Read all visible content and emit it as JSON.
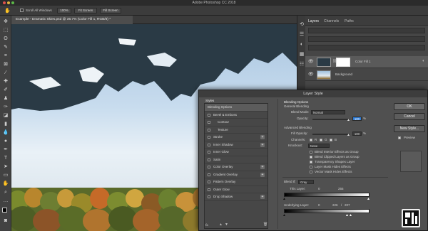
{
  "titlebar": {
    "title": "Adobe Photoshop CC 2018"
  },
  "options_bar": {
    "scroll_all_windows": "Scroll All Windows",
    "zoom": "100%",
    "fit_screen": "Fit Screen",
    "fill_screen": "Fill Screen"
  },
  "document": {
    "tab_title": "Example - Dramatic Skies.psd @ 36.7% (Color Fill 1, RGB/8) *"
  },
  "layers_panel": {
    "tabs": [
      "Layers",
      "Channels",
      "Paths"
    ],
    "layers": [
      {
        "name": "Color Fill 1"
      },
      {
        "name": "Background"
      }
    ]
  },
  "dialog": {
    "title": "Layer Style",
    "styles_header": "Styles",
    "style_items": [
      {
        "label": "Blending Options",
        "plus": false,
        "checkbox": false
      },
      {
        "label": "Bevel & Emboss",
        "plus": false,
        "checkbox": true
      },
      {
        "label": "Contour",
        "plus": false,
        "checkbox": true
      },
      {
        "label": "Texture",
        "plus": false,
        "checkbox": true
      },
      {
        "label": "Stroke",
        "plus": true,
        "checkbox": true
      },
      {
        "label": "Inner Shadow",
        "plus": true,
        "checkbox": true
      },
      {
        "label": "Inner Glow",
        "plus": false,
        "checkbox": true
      },
      {
        "label": "Satin",
        "plus": false,
        "checkbox": true
      },
      {
        "label": "Color Overlay",
        "plus": true,
        "checkbox": true
      },
      {
        "label": "Gradient Overlay",
        "plus": true,
        "checkbox": true
      },
      {
        "label": "Pattern Overlay",
        "plus": false,
        "checkbox": true
      },
      {
        "label": "Outer Glow",
        "plus": false,
        "checkbox": true
      },
      {
        "label": "Drop Shadow",
        "plus": true,
        "checkbox": true
      }
    ],
    "fx_label": "fx.",
    "blending_options": {
      "header": "Blending Options",
      "general": "General Blending",
      "blend_mode_label": "Blend Mode:",
      "blend_mode_value": "Normal",
      "opacity_label": "Opacity:",
      "opacity_value": "100",
      "percent": "%",
      "advanced": "Advanced Blending",
      "fill_opacity_label": "Fill Opacity:",
      "fill_opacity_value": "100",
      "channels_label": "Channels:",
      "channel_r": "R",
      "channel_g": "G",
      "channel_b": "B",
      "knockout_label": "Knockout:",
      "knockout_value": "None",
      "checks": [
        "Blend Interior Effects as Group",
        "Blend Clipped Layers as Group",
        "Transparency Shapes Layer",
        "Layer Mask Hides Effects",
        "Vector Mask Hides Effects"
      ],
      "blend_if_label": "Blend If:",
      "blend_if_value": "Gray",
      "this_layer_label": "This Layer:",
      "this_layer_min": "0",
      "this_layer_max": "255",
      "underlying_label": "Underlying Layer:",
      "underlying_min": "0",
      "underlying_split": "226",
      "underlying_sep": "/",
      "underlying_max": "207"
    },
    "buttons": {
      "ok": "OK",
      "cancel": "Cancel",
      "new_style": "New Style...",
      "preview": "Preview"
    }
  },
  "colors": {
    "accent": "#2d7bd6",
    "sky_mask": "#2a3a45"
  }
}
